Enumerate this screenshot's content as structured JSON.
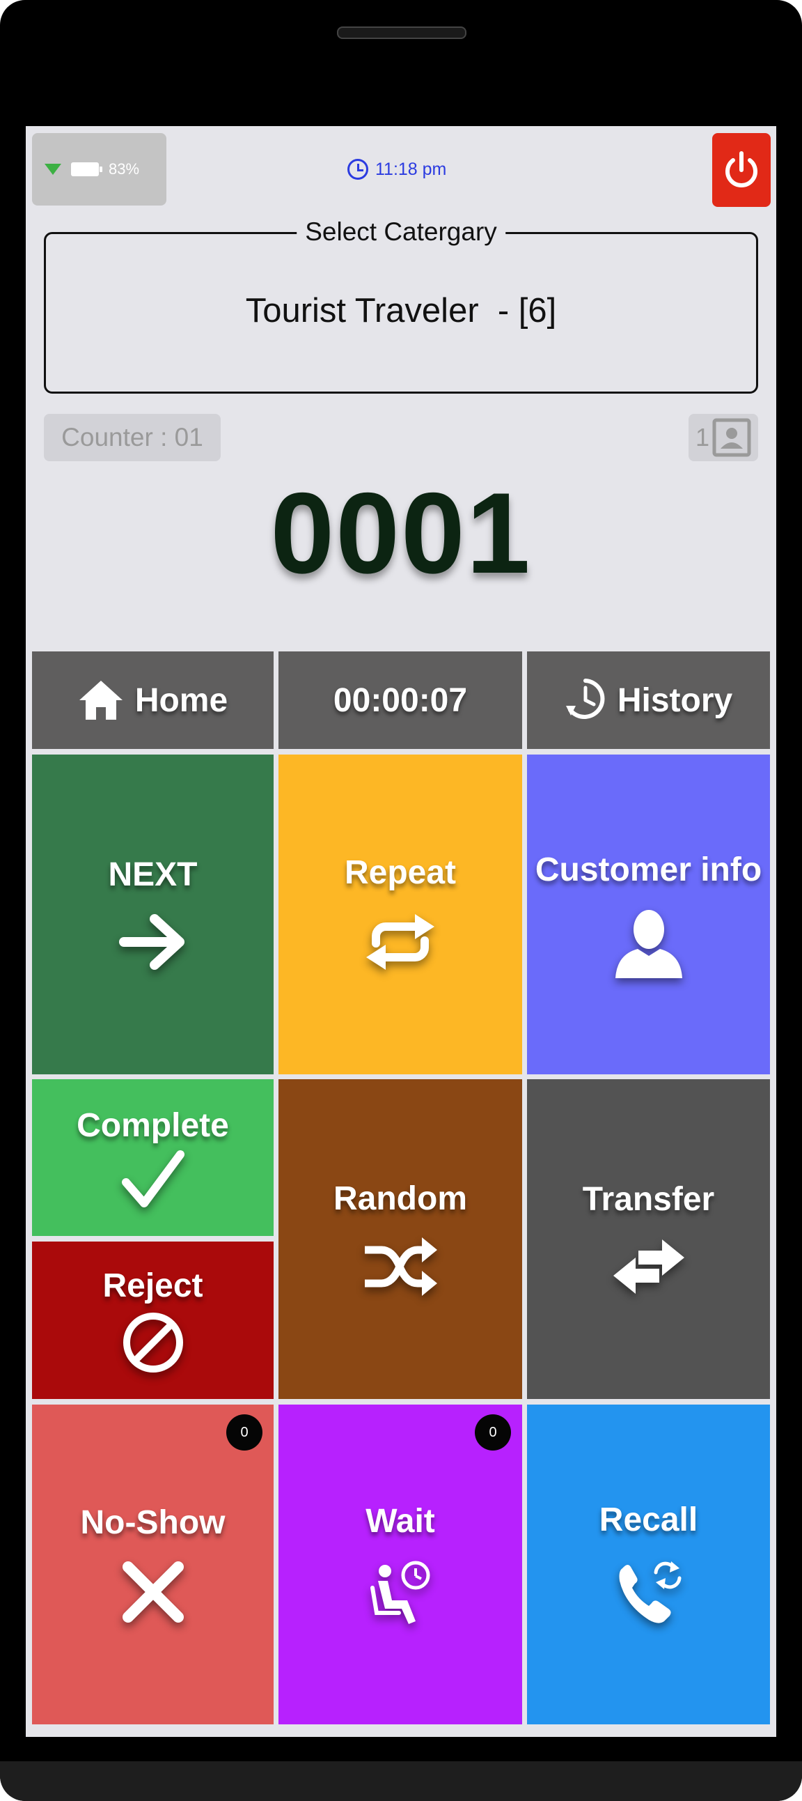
{
  "status": {
    "battery_percent": "83%",
    "time": "11:18 pm",
    "wifi_color": "#3cb043",
    "power_color": "#e12917"
  },
  "category": {
    "legend": "Select Catergary",
    "value": "Tourist Traveler  - [6]"
  },
  "counter": {
    "label": "Counter : 01",
    "user_count": "1"
  },
  "ticket_number": "0001",
  "nav": {
    "home_label": "Home",
    "timer": "00:00:07",
    "history_label": "History"
  },
  "tiles": {
    "next": {
      "label": "NEXT",
      "color": "#367a4b",
      "icon": "arrow-right-icon"
    },
    "repeat": {
      "label": "Repeat",
      "color": "#fdb725",
      "icon": "repeat-icon"
    },
    "customer_info": {
      "label": "Customer info",
      "color": "#6a6bfa",
      "icon": "person-icon"
    },
    "complete": {
      "label": "Complete",
      "color": "#44bf5d",
      "icon": "checkmark-icon"
    },
    "reject": {
      "label": "Reject",
      "color": "#aa0a0b",
      "icon": "prohibited-icon"
    },
    "random": {
      "label": "Random",
      "color": "#8a4714",
      "icon": "shuffle-icon"
    },
    "transfer": {
      "label": "Transfer",
      "color": "#535353",
      "icon": "transfer-arrows-icon"
    },
    "no_show": {
      "label": "No-Show",
      "color": "#df5957",
      "icon": "x-icon",
      "count": "0"
    },
    "wait": {
      "label": "Wait",
      "color": "#b721fe",
      "icon": "seated-clock-icon",
      "count": "0"
    },
    "recall": {
      "label": "Recall",
      "color": "#2394ef",
      "icon": "phone-refresh-icon"
    }
  }
}
